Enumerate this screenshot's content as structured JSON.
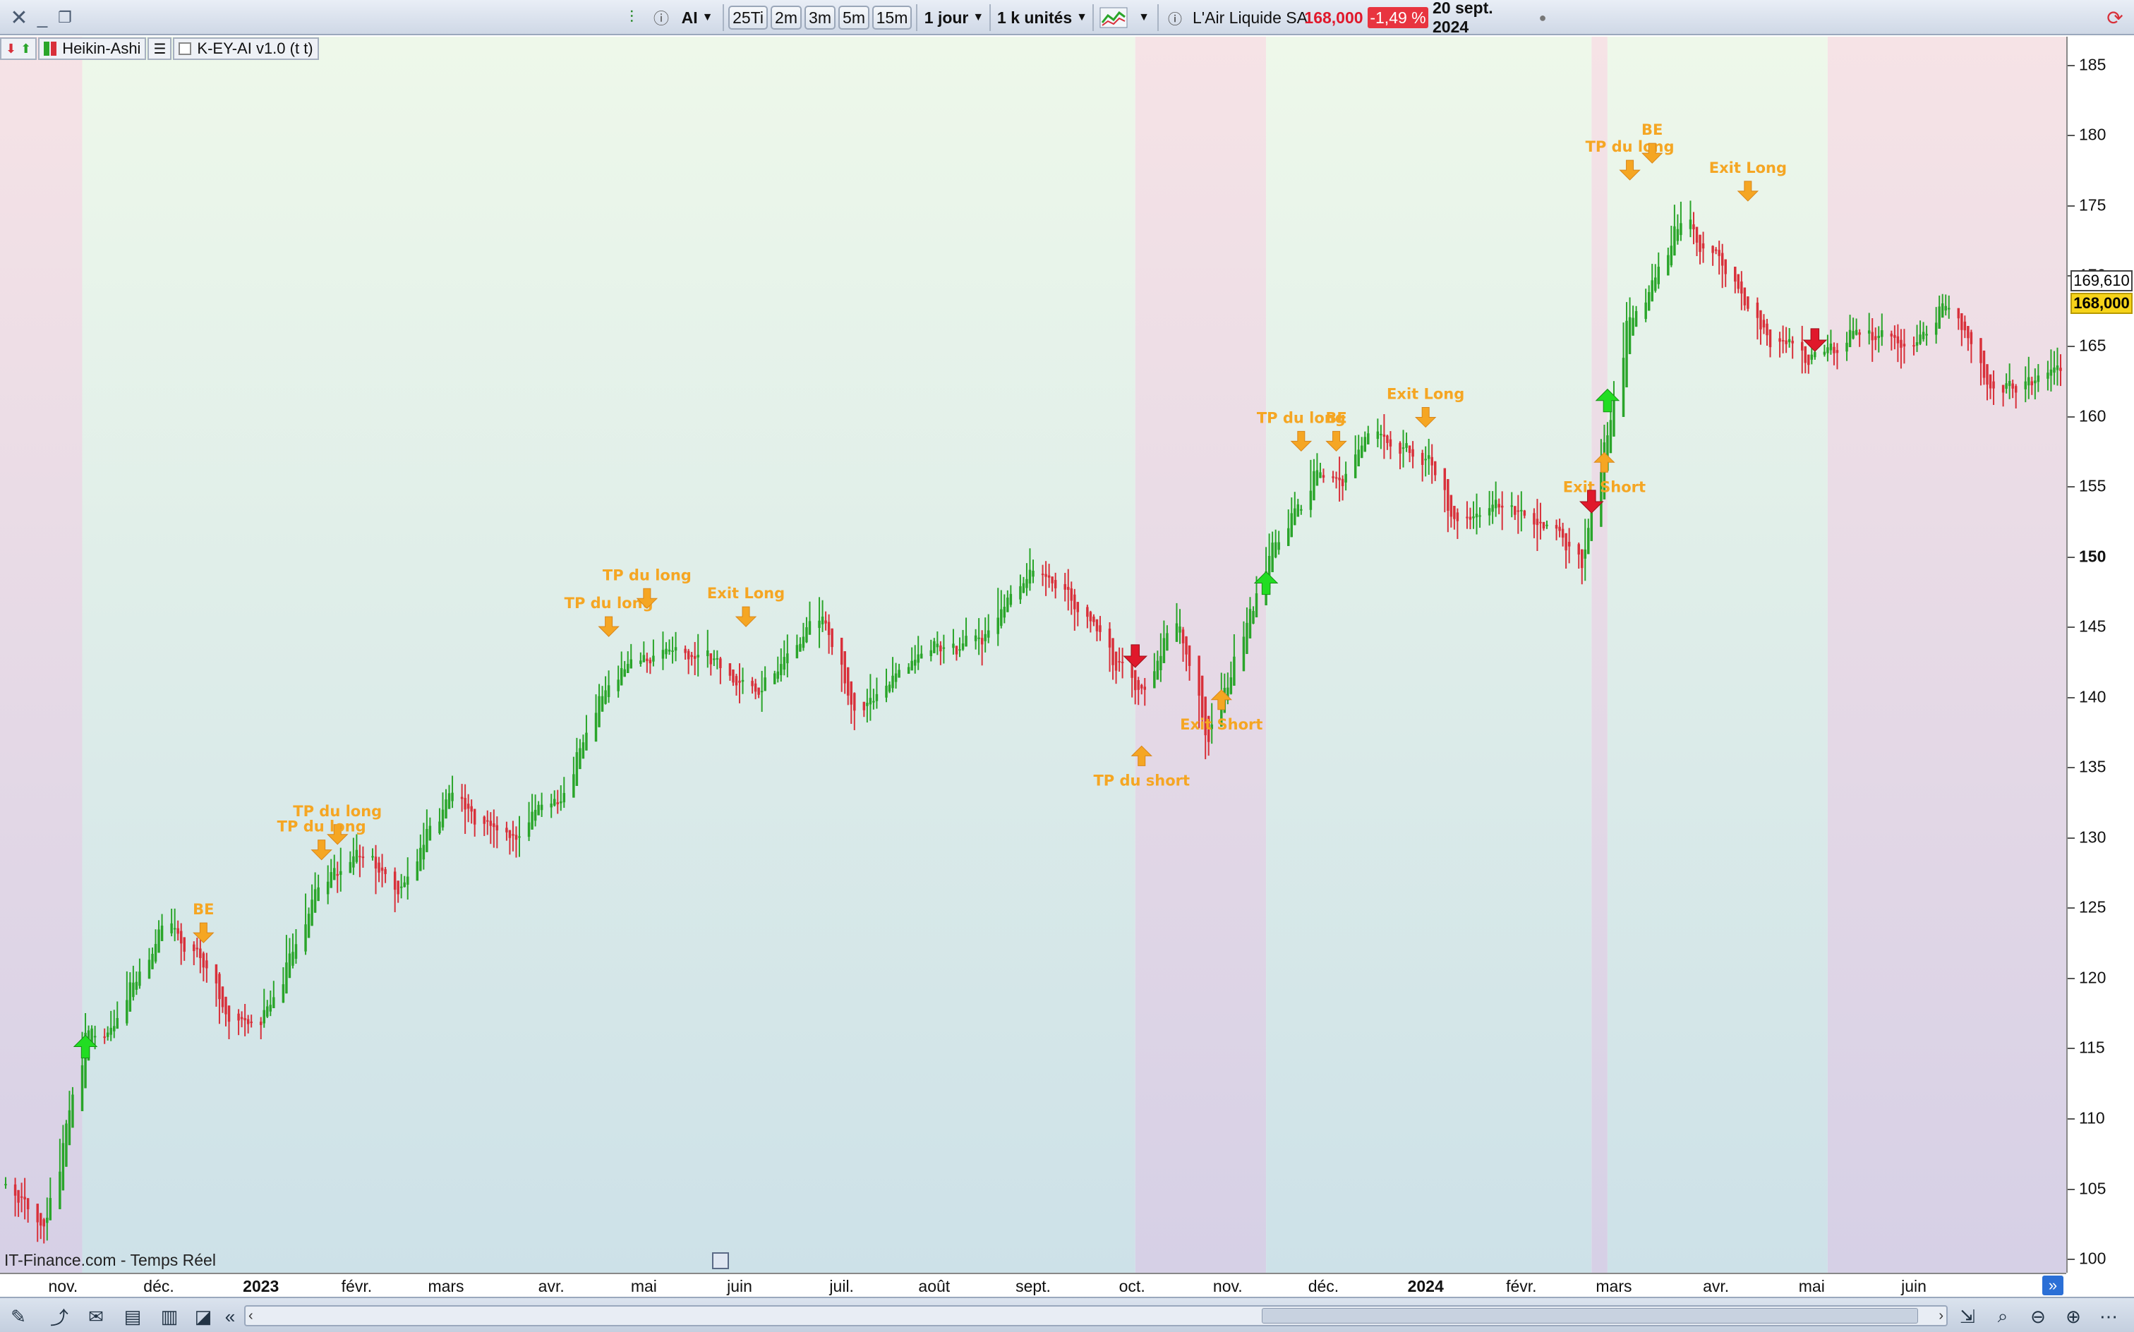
{
  "toolbar": {
    "close_icon": "close-icon",
    "ticker": "AI",
    "intervals": [
      "25Ti",
      "2m",
      "3m",
      "5m",
      "15m"
    ],
    "period": "1 jour",
    "units": "1 k unités",
    "instrument": "L'Air Liquide SA",
    "last_price": "168,000",
    "change_pct": "-1,49 %",
    "date": "20 sept. 2024",
    "colors": {
      "price_red": "#e0182b",
      "change_bg": "#e8343f"
    }
  },
  "chips": {
    "chart_style": "Heikin-Ashi",
    "indicator": "K-EY-AI v1.0 (t t)"
  },
  "chart_footer": "IT-Finance.com - Temps Réel",
  "axis": {
    "y_ticks": [
      "185",
      "180",
      "175",
      "170",
      "165",
      "160",
      "155",
      "150",
      "145",
      "140",
      "135",
      "130",
      "125",
      "120",
      "115",
      "110",
      "105",
      "100"
    ],
    "price_tag_1": "169,610",
    "price_tag_2": "168,000",
    "x_ticks": [
      "nov.",
      "déc.",
      "2023",
      "févr.",
      "mars",
      "avr.",
      "mai",
      "juin",
      "juil.",
      "août",
      "sept.",
      "oct.",
      "nov.",
      "déc.",
      "2024",
      "févr.",
      "mars",
      "avr.",
      "mai",
      "juin"
    ]
  },
  "chart_data": {
    "type": "candlestick",
    "style": "Heikin-Ashi",
    "ylim": [
      99,
      187
    ],
    "x_domain": [
      "2022-10-14",
      "2024-07-19"
    ],
    "grid": false,
    "colors": {
      "up": "#2aa52a",
      "down": "#d8303a",
      "bull_zone": "#e6f5e6",
      "bear_zone": "#f4e1e8",
      "annotation": "#f5a623",
      "buy_arrow": "#22dd22",
      "sell_arrow": "#e0182b"
    },
    "anchors": [
      {
        "date": "2022-10-14",
        "close": 105
      },
      {
        "date": "2022-10-26",
        "close": 102
      },
      {
        "date": "2022-11-07",
        "close": 116
      },
      {
        "date": "2022-11-15",
        "close": 116
      },
      {
        "date": "2022-11-28",
        "close": 122
      },
      {
        "date": "2022-12-01",
        "close": 124
      },
      {
        "date": "2022-12-14",
        "close": 121
      },
      {
        "date": "2022-12-23",
        "close": 117
      },
      {
        "date": "2023-01-02",
        "close": 117
      },
      {
        "date": "2023-01-18",
        "close": 126
      },
      {
        "date": "2023-02-01",
        "close": 129
      },
      {
        "date": "2023-02-14",
        "close": 126
      },
      {
        "date": "2023-03-01",
        "close": 133
      },
      {
        "date": "2023-03-20",
        "close": 130
      },
      {
        "date": "2023-04-06",
        "close": 133
      },
      {
        "date": "2023-04-20",
        "close": 141
      },
      {
        "date": "2023-05-01",
        "close": 143
      },
      {
        "date": "2023-05-24",
        "close": 143
      },
      {
        "date": "2023-06-05",
        "close": 140
      },
      {
        "date": "2023-06-26",
        "close": 146
      },
      {
        "date": "2023-07-06",
        "close": 139
      },
      {
        "date": "2023-07-27",
        "close": 143
      },
      {
        "date": "2023-08-14",
        "close": 144
      },
      {
        "date": "2023-09-01",
        "close": 149
      },
      {
        "date": "2023-09-12",
        "close": 147
      },
      {
        "date": "2023-09-28",
        "close": 142
      },
      {
        "date": "2023-10-05",
        "close": 140
      },
      {
        "date": "2023-10-16",
        "close": 146
      },
      {
        "date": "2023-10-25",
        "close": 137
      },
      {
        "date": "2023-11-06",
        "close": 145
      },
      {
        "date": "2023-11-15",
        "close": 151
      },
      {
        "date": "2023-11-30",
        "close": 156
      },
      {
        "date": "2023-12-06",
        "close": 155
      },
      {
        "date": "2023-12-15",
        "close": 159
      },
      {
        "date": "2024-01-02",
        "close": 157
      },
      {
        "date": "2024-01-10",
        "close": 152
      },
      {
        "date": "2024-01-26",
        "close": 154
      },
      {
        "date": "2024-02-07",
        "close": 152
      },
      {
        "date": "2024-02-20",
        "close": 150
      },
      {
        "date": "2024-02-29",
        "close": 161
      },
      {
        "date": "2024-03-05",
        "close": 167
      },
      {
        "date": "2024-03-15",
        "close": 171
      },
      {
        "date": "2024-03-22",
        "close": 174
      },
      {
        "date": "2024-04-03",
        "close": 171
      },
      {
        "date": "2024-04-17",
        "close": 166
      },
      {
        "date": "2024-05-02",
        "close": 164
      },
      {
        "date": "2024-05-15",
        "close": 166
      },
      {
        "date": "2024-06-03",
        "close": 165
      },
      {
        "date": "2024-06-13",
        "close": 168
      },
      {
        "date": "2024-06-26",
        "close": 162
      },
      {
        "date": "2024-07-19",
        "close": 163.5
      }
    ],
    "zones": [
      {
        "from": "2022-10-14",
        "to": "2022-11-07",
        "kind": "bear"
      },
      {
        "from": "2022-11-07",
        "to": "2023-10-03",
        "kind": "bull"
      },
      {
        "from": "2023-10-03",
        "to": "2023-11-13",
        "kind": "bear"
      },
      {
        "from": "2023-11-13",
        "to": "2024-02-23",
        "kind": "bull"
      },
      {
        "from": "2024-02-23",
        "to": "2024-02-28",
        "kind": "bear"
      },
      {
        "from": "2024-02-28",
        "to": "2024-05-07",
        "kind": "bull"
      },
      {
        "from": "2024-05-07",
        "to": "2024-07-19",
        "kind": "bear"
      }
    ],
    "signals": [
      {
        "date": "2022-11-08",
        "price": 114.5,
        "kind": "buy"
      },
      {
        "date": "2023-10-03",
        "price": 143.5,
        "kind": "sell"
      },
      {
        "date": "2023-11-13",
        "price": 147.5,
        "kind": "buy"
      },
      {
        "date": "2024-02-23",
        "price": 154.5,
        "kind": "sell"
      },
      {
        "date": "2024-02-28",
        "price": 160.5,
        "kind": "buy"
      },
      {
        "date": "2024-05-03",
        "price": 166,
        "kind": "sell"
      }
    ],
    "annotations": [
      {
        "date": "2022-12-15",
        "price": 122.5,
        "dir": "down",
        "text": "BE"
      },
      {
        "date": "2023-01-26",
        "price": 129.5,
        "dir": "down",
        "text": "TP du long"
      },
      {
        "date": "2023-01-21",
        "price": 128.4,
        "dir": "down",
        "text": "TP du long"
      },
      {
        "date": "2023-04-21",
        "price": 144.3,
        "dir": "down",
        "text": "TP du long"
      },
      {
        "date": "2023-05-03",
        "price": 146.3,
        "dir": "down",
        "text": "TP du long"
      },
      {
        "date": "2023-06-03",
        "price": 145.0,
        "dir": "down",
        "text": "Exit Long"
      },
      {
        "date": "2023-10-05",
        "price": 136.5,
        "dir": "up",
        "text": "TP du short"
      },
      {
        "date": "2023-10-30",
        "price": 140.5,
        "dir": "up",
        "text": "Exit Short"
      },
      {
        "date": "2023-11-24",
        "price": 157.5,
        "dir": "down",
        "text": "TP du long"
      },
      {
        "date": "2023-12-05",
        "price": 157.5,
        "dir": "down",
        "text": "BE"
      },
      {
        "date": "2024-01-02",
        "price": 159.2,
        "dir": "down",
        "text": "Exit Long"
      },
      {
        "date": "2024-02-27",
        "price": 157.4,
        "dir": "up",
        "text": "Exit Short"
      },
      {
        "date": "2024-03-06",
        "price": 176.8,
        "dir": "down",
        "text": "TP du long"
      },
      {
        "date": "2024-03-13",
        "price": 178.0,
        "dir": "down",
        "text": "BE"
      },
      {
        "date": "2024-04-12",
        "price": 175.3,
        "dir": "down",
        "text": "Exit Long"
      }
    ]
  }
}
